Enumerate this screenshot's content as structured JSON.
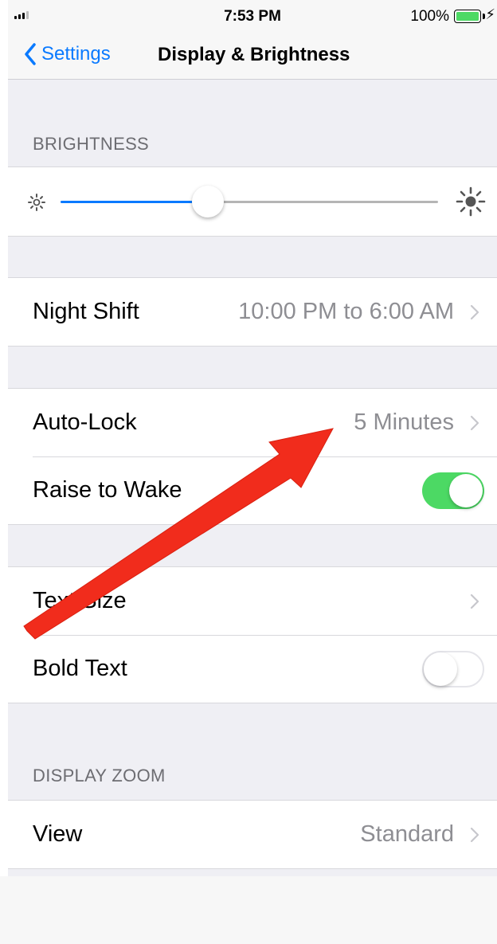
{
  "status_bar": {
    "time": "7:53 PM",
    "battery_percent": "100%"
  },
  "nav": {
    "back_label": "Settings",
    "title": "Display & Brightness"
  },
  "brightness": {
    "header": "BRIGHTNESS",
    "level": 0.39
  },
  "night_shift": {
    "label": "Night Shift",
    "value": "10:00 PM to 6:00 AM"
  },
  "auto_lock": {
    "label": "Auto-Lock",
    "value": "5 Minutes"
  },
  "raise_to_wake": {
    "label": "Raise to Wake",
    "on": true
  },
  "text_size": {
    "label": "Text Size"
  },
  "bold_text": {
    "label": "Bold Text",
    "on": false
  },
  "display_zoom": {
    "header": "DISPLAY ZOOM",
    "view_label": "View",
    "view_value": "Standard"
  },
  "colors": {
    "accent": "#0a7aff",
    "toggle_on": "#4cd964",
    "annotation_arrow": "#f12c1c"
  },
  "icons": [
    "chevron-left-icon",
    "sun-small-icon",
    "sun-large-icon",
    "chevron-right-icon",
    "lightning-bolt-icon"
  ]
}
